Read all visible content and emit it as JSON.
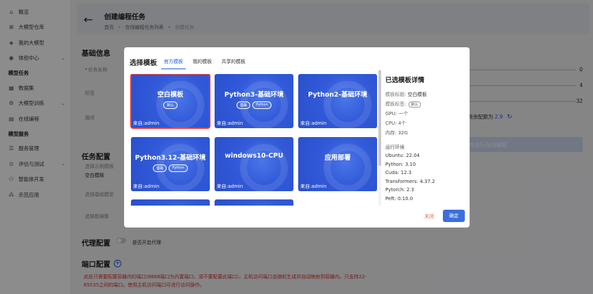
{
  "sidebar": {
    "items": [
      {
        "type": "item",
        "icon": "home-icon",
        "glyph": "⌂",
        "label": "概览"
      },
      {
        "type": "item",
        "icon": "grid-icon",
        "glyph": "⊞",
        "label": "大模型仓库"
      },
      {
        "type": "item",
        "icon": "model-icon",
        "glyph": "◈",
        "label": "我的大模型"
      },
      {
        "type": "item",
        "icon": "experience-icon",
        "glyph": "◉",
        "label": "体验中心",
        "chevron": true
      },
      {
        "type": "group",
        "label": "模型任务"
      },
      {
        "type": "item",
        "icon": "dataset-icon",
        "glyph": "▦",
        "label": "数据集"
      },
      {
        "type": "item",
        "icon": "training-icon",
        "glyph": "⚙",
        "label": "大模型训练",
        "chevron": true
      },
      {
        "type": "item",
        "icon": "code-icon",
        "glyph": "▤",
        "label": "在线编程"
      },
      {
        "type": "group",
        "label": "模型服务"
      },
      {
        "type": "item",
        "icon": "service-icon",
        "glyph": "☰",
        "label": "服务管理"
      },
      {
        "type": "item",
        "icon": "eval-icon",
        "glyph": "⊙",
        "label": "评估与测试",
        "chevron": true
      },
      {
        "type": "item",
        "icon": "agent-icon",
        "glyph": "⚇",
        "label": "智能体开发"
      },
      {
        "type": "item",
        "icon": "demo-icon",
        "glyph": "⁂",
        "label": "示范应用"
      }
    ]
  },
  "header": {
    "title": "创建编程任务",
    "breadcrumb": [
      "首页",
      "在线编程任务列表",
      "创建任务"
    ]
  },
  "basic": {
    "title": "基础信息",
    "task_name_label": "任务名称",
    "tag_label": "标签",
    "desc_label": "描述"
  },
  "task_config": {
    "title": "任务配置",
    "template_label": "选择示例模板",
    "template_value": "空白模板",
    "base_model_label": "选择基础模型",
    "dataset_label": "选择数据集"
  },
  "resource": {
    "stat1": "0",
    "stat2": "4",
    "stat3": "32",
    "quota_label": "剩余配额为",
    "quota_value": "2.9",
    "run_button": "并运行在线编程"
  },
  "proxy": {
    "title": "代理配置",
    "toggle_label": "是否开启代理"
  },
  "port": {
    "title": "端口配置",
    "note": "此处只需要配置容器内的端口(8888端口为内置端口，请不要配置此端口)，主机访问端口会随机生成并自动映射到容器内，只支持22-65535之间的端口，使用主机访问端口可进行访问操作。"
  },
  "modal": {
    "title": "选择模板",
    "tabs": [
      "官方模板",
      "我的模板",
      "共享的模板"
    ],
    "active_tab": 0,
    "cards": [
      {
        "name": "空白模板",
        "tags": [
          "默认"
        ],
        "source": "来自:admin",
        "selected": true
      },
      {
        "name": "Python3-基础环境",
        "tags": [
          "基础",
          "Python"
        ],
        "source": "来自:admin"
      },
      {
        "name": "Python2-基础环境",
        "tags": [],
        "source": "来自:admin"
      },
      {
        "name": "Python3.12-基础环境",
        "tags": [
          "基础",
          "Python"
        ],
        "source": "来自:admin"
      },
      {
        "name": "windows10-CPU",
        "tags": [],
        "source": "来自:admin"
      },
      {
        "name": "应用部署",
        "tags": [],
        "source": "来自:admin"
      },
      {
        "name": "",
        "tags": [],
        "source": ""
      },
      {
        "name": "",
        "tags": [],
        "source": ""
      }
    ],
    "detail": {
      "title": "已选模板详情",
      "name_label": "模板标题:",
      "name_value": "空白模板",
      "tag_label": "模板标签:",
      "tag_value": "默认",
      "gpu": "GPU: 一个",
      "cpu": "CPU: 4个",
      "mem": "内存: 32G",
      "env_title": "运行环境",
      "env": [
        "Ubuntu: 22.04",
        "Python: 3.10",
        "Cuda: 12.3",
        "Transformers: 4.37.2",
        "Pytorch: 2.3",
        "Peft: 0.10.0"
      ]
    },
    "close_label": "关闭",
    "ok_label": "确定"
  },
  "colors": {
    "accent": "#1f5ddb",
    "selected_outline": "#e53935",
    "card_blue": "#3159d8"
  }
}
